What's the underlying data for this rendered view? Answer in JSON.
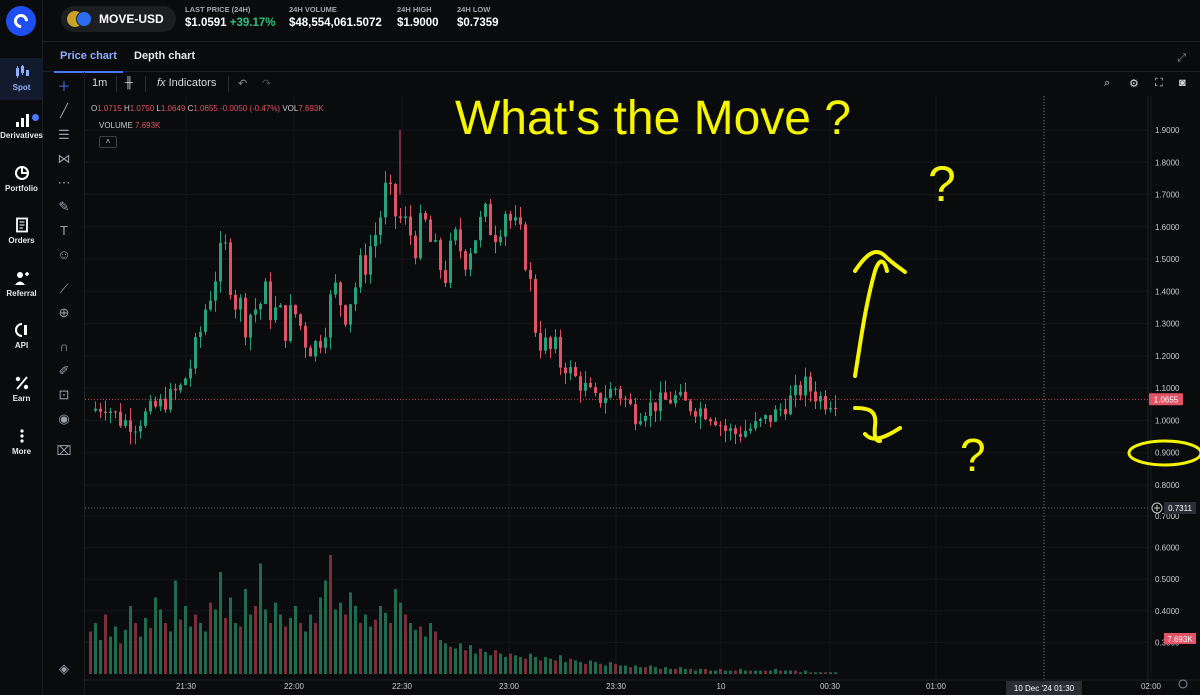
{
  "header": {
    "pair": "MOVE-USD",
    "stats": [
      {
        "label": "LAST PRICE (24H)",
        "value": "$1.0591",
        "change": "+39.17%"
      },
      {
        "label": "24H VOLUME",
        "value": "$48,554,061.5072"
      },
      {
        "label": "24H HIGH",
        "value": "$1.9000"
      },
      {
        "label": "24H LOW",
        "value": "$0.7359"
      }
    ]
  },
  "nav": [
    {
      "label": "Spot",
      "icon": "candlestick-icon"
    },
    {
      "label": "Derivatives",
      "icon": "bar-chart-icon"
    },
    {
      "label": "Portfolio",
      "icon": "pie-chart-icon"
    },
    {
      "label": "Orders",
      "icon": "document-icon"
    },
    {
      "label": "Referral",
      "icon": "add-user-icon"
    },
    {
      "label": "API",
      "icon": "api-icon"
    },
    {
      "label": "Earn",
      "icon": "percent-icon"
    },
    {
      "label": "More",
      "icon": "more-icon"
    }
  ],
  "tabs": [
    "Price chart",
    "Depth chart"
  ],
  "toolbar": {
    "interval": "1m",
    "indicators": "Indicators"
  },
  "legend": {
    "o_label": "O",
    "o": "1.0715",
    "h_label": "H",
    "h": "1.0750",
    "l_label": "L",
    "l": "1.0649",
    "c_label": "C",
    "c": "1.0655",
    "change": "-0.0050 (-0.47%)",
    "vol_label": "VOL",
    "vol": "7.693K",
    "volume_label": "VOLUME",
    "volume": "7.693K"
  },
  "annotation": {
    "text": "What's the Move ?",
    "marks": [
      "?",
      "?"
    ]
  },
  "colors": {
    "up": "#26a17b",
    "down": "#e05468",
    "accent": "#4a7bff",
    "annotation": "#f5f500"
  },
  "chart_data": {
    "type": "candlestick",
    "price_ticks": [
      "1.9000",
      "1.8000",
      "1.7000",
      "1.6000",
      "1.5000",
      "1.4000",
      "1.3000",
      "1.2000",
      "1.1000",
      "1.0000",
      "0.9000",
      "0.8000",
      "0.7000",
      "0.6000",
      "0.5000",
      "0.4000",
      "0.3000"
    ],
    "time_ticks": [
      "21:30",
      "22:00",
      "22:30",
      "23:00",
      "23:30",
      "10",
      "00:30",
      "01:00",
      "01:30",
      "02:00"
    ],
    "crosshair_time": "10 Dec '24  01:30",
    "current_price": "1.0655",
    "crosshair_price": "0.7311",
    "volume_label": "7.693K",
    "price_path": [
      [
        0,
        1.03
      ],
      [
        3,
        1.05
      ],
      [
        6,
        1.0
      ],
      [
        9,
        0.99
      ],
      [
        12,
        1.03
      ],
      [
        15,
        1.06
      ],
      [
        18,
        1.1
      ],
      [
        21,
        1.2
      ],
      [
        23,
        1.35
      ],
      [
        25,
        1.46
      ],
      [
        27,
        1.52
      ],
      [
        29,
        1.38
      ],
      [
        31,
        1.32
      ],
      [
        33,
        1.35
      ],
      [
        35,
        1.38
      ],
      [
        37,
        1.33
      ],
      [
        39,
        1.3
      ],
      [
        41,
        1.33
      ],
      [
        43,
        1.26
      ],
      [
        45,
        1.23
      ],
      [
        47,
        1.32
      ],
      [
        49,
        1.4
      ],
      [
        51,
        1.35
      ],
      [
        53,
        1.42
      ],
      [
        55,
        1.5
      ],
      [
        57,
        1.58
      ],
      [
        59,
        1.7
      ],
      [
        61,
        1.64
      ],
      [
        63,
        1.6
      ],
      [
        65,
        1.56
      ],
      [
        67,
        1.6
      ],
      [
        69,
        1.5
      ],
      [
        71,
        1.46
      ],
      [
        73,
        1.55
      ],
      [
        75,
        1.52
      ],
      [
        77,
        1.58
      ],
      [
        79,
        1.62
      ],
      [
        81,
        1.6
      ],
      [
        83,
        1.66
      ],
      [
        85,
        1.58
      ],
      [
        87,
        1.52
      ],
      [
        89,
        1.3
      ],
      [
        91,
        1.22
      ],
      [
        93,
        1.2
      ],
      [
        95,
        1.17
      ],
      [
        97,
        1.13
      ],
      [
        99,
        1.1
      ],
      [
        101,
        1.06
      ],
      [
        103,
        1.08
      ],
      [
        105,
        1.1
      ],
      [
        107,
        1.06
      ],
      [
        109,
        1.02
      ],
      [
        111,
        1.04
      ],
      [
        113,
        1.05
      ],
      [
        115,
        1.06
      ],
      [
        117,
        1.07
      ],
      [
        119,
        1.05
      ],
      [
        121,
        1.04
      ],
      [
        123,
        1.03
      ],
      [
        125,
        1.01
      ],
      [
        127,
        0.97
      ],
      [
        129,
        0.96
      ],
      [
        131,
        0.97
      ],
      [
        133,
        0.98
      ],
      [
        135,
        1.0
      ],
      [
        137,
        1.02
      ],
      [
        139,
        1.05
      ],
      [
        141,
        1.08
      ],
      [
        143,
        1.11
      ],
      [
        145,
        1.08
      ],
      [
        147,
        1.06
      ],
      [
        149,
        1.07
      ]
    ],
    "volume": [
      0.25,
      0.3,
      0.2,
      0.35,
      0.22,
      0.28,
      0.18,
      0.26,
      0.4,
      0.3,
      0.22,
      0.33,
      0.27,
      0.45,
      0.38,
      0.3,
      0.25,
      0.55,
      0.32,
      0.4,
      0.28,
      0.35,
      0.3,
      0.25,
      0.42,
      0.38,
      0.6,
      0.33,
      0.45,
      0.3,
      0.28,
      0.5,
      0.35,
      0.4,
      0.65,
      0.38,
      0.3,
      0.42,
      0.35,
      0.28,
      0.33,
      0.4,
      0.3,
      0.25,
      0.35,
      0.3,
      0.45,
      0.55,
      0.7,
      0.38,
      0.42,
      0.35,
      0.48,
      0.4,
      0.3,
      0.35,
      0.28,
      0.32,
      0.4,
      0.36,
      0.3,
      0.5,
      0.42,
      0.35,
      0.3,
      0.26,
      0.28,
      0.22,
      0.3,
      0.25,
      0.2,
      0.18,
      0.16,
      0.15,
      0.18,
      0.14,
      0.17,
      0.12,
      0.15,
      0.13,
      0.11,
      0.14,
      0.12,
      0.1,
      0.12,
      0.11,
      0.1,
      0.09,
      0.12,
      0.1,
      0.08,
      0.1,
      0.09,
      0.08,
      0.11,
      0.07,
      0.09,
      0.08,
      0.07,
      0.06,
      0.08,
      0.07,
      0.06,
      0.05,
      0.07,
      0.06,
      0.05,
      0.05,
      0.04,
      0.05,
      0.04,
      0.04,
      0.05,
      0.04,
      0.03,
      0.04,
      0.03,
      0.03,
      0.04,
      0.03,
      0.03,
      0.02,
      0.03,
      0.03,
      0.02,
      0.02,
      0.03,
      0.02,
      0.02,
      0.02,
      0.03,
      0.02,
      0.02,
      0.02,
      0.02,
      0.02,
      0.02,
      0.03,
      0.02,
      0.02,
      0.02,
      0.02,
      0.01,
      0.02,
      0.01,
      0.01,
      0.01,
      0.01,
      0.01,
      0.01
    ]
  }
}
